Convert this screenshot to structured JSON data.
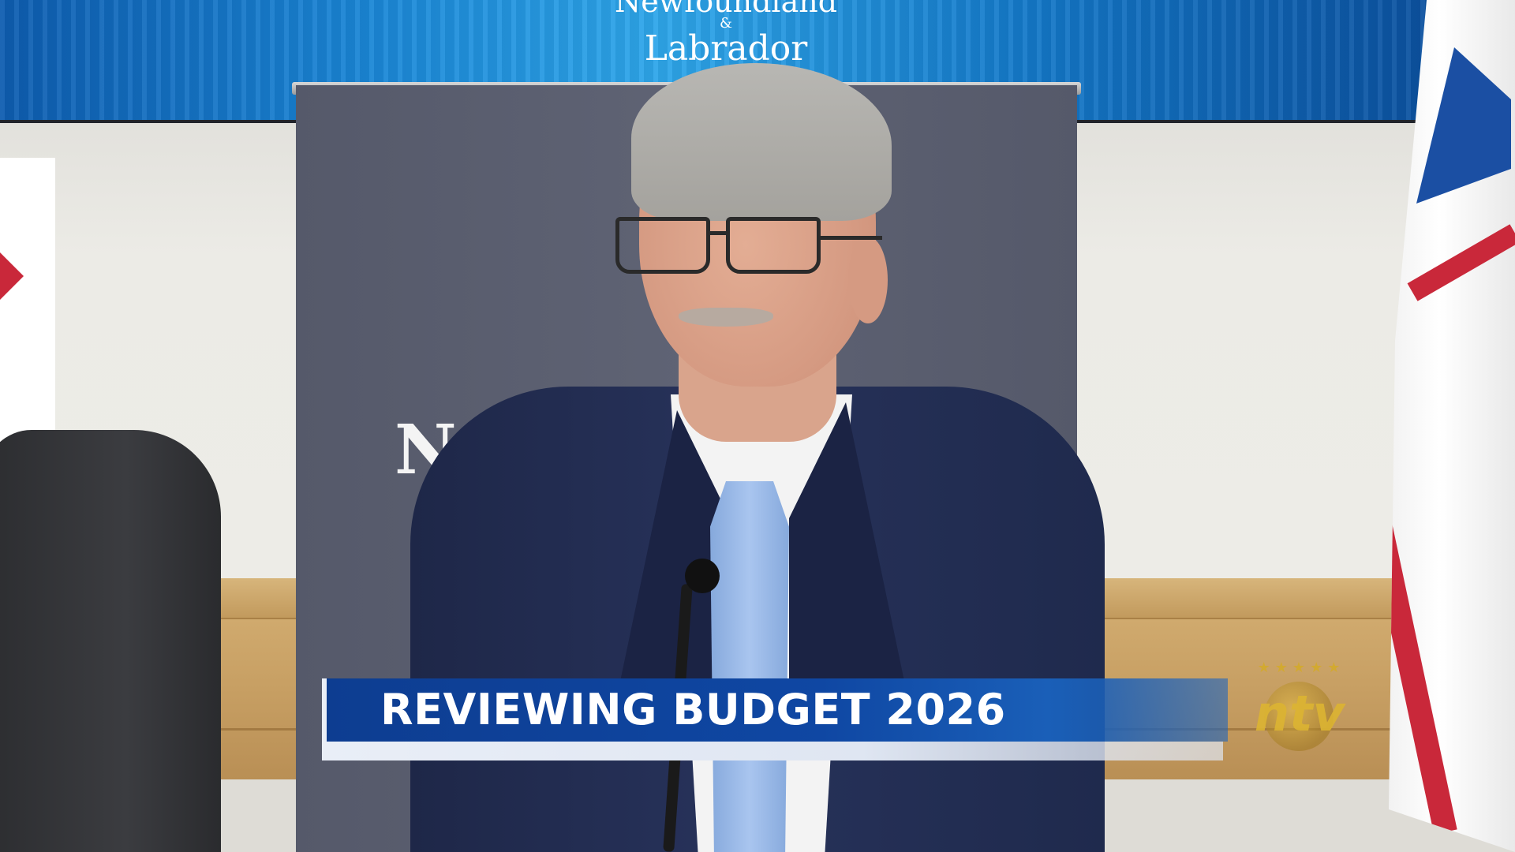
{
  "screen": {
    "title_line1": "Newfoundland",
    "title_amp": "&",
    "title_line2": "Labrador"
  },
  "banner": {
    "text": "Newfoundland"
  },
  "lower_third": {
    "headline": "REVIEWING BUDGET 2026"
  },
  "logo": {
    "text": "ntv",
    "stars": "★★★★★"
  }
}
